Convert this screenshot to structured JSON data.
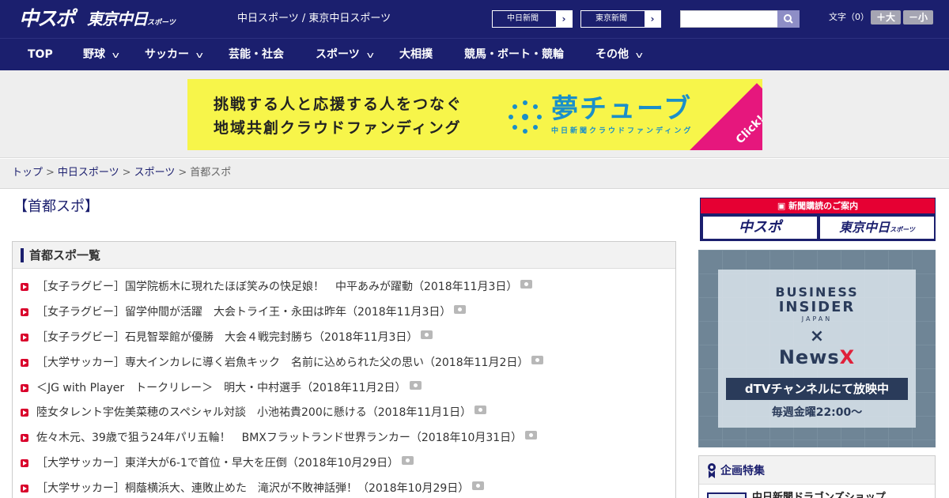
{
  "header": {
    "logo_chuspo": "中スポ",
    "logo_tokyo": "東京中日",
    "logo_tokyo_small": "スポーツ",
    "caption": "中日スポーツ / 東京中日スポーツ",
    "btn_chunichi": "中日新聞",
    "btn_tokyo": "東京新聞",
    "search_placeholder": "",
    "moji_label": "文字（0）",
    "size_up": "＋大",
    "size_down": "－小"
  },
  "nav": {
    "items": [
      {
        "label": "TOP"
      },
      {
        "label": "野球"
      },
      {
        "label": "サッカー"
      },
      {
        "label": "芸能・社会"
      },
      {
        "label": "スポーツ"
      },
      {
        "label": "大相撲"
      },
      {
        "label": "競馬・ボート・競輪"
      },
      {
        "label": "その他"
      }
    ]
  },
  "ad": {
    "line1": "挑戦する人と応援する人をつなぐ",
    "line2": "地域共創クラウドファンディング",
    "logo": "夢チューブ",
    "sub": "中日新聞クラウドファンディング",
    "click": "Click!"
  },
  "breadcrumb": {
    "top": "トップ",
    "chunichi": "中日スポーツ",
    "sports": "スポーツ",
    "current": "首都スポ",
    "sep": ">"
  },
  "main": {
    "title": "【首都スポ】",
    "list_title": "首都スポ一覧",
    "articles": [
      {
        "text": "［女子ラグビー］国学院栃木に現れたほぼ笑みの快足娘！　中平あみが躍動（2018年11月3日）"
      },
      {
        "text": "［女子ラグビー］留学仲間が活躍　大会トライ王・永田は昨年（2018年11月3日）"
      },
      {
        "text": "［女子ラグビー］石見智翠館が優勝　大会４戦完封勝ち（2018年11月3日）"
      },
      {
        "text": "［大学サッカー］専大インカレに導く岩魚キック　名前に込められた父の思い（2018年11月2日）"
      },
      {
        "text": "＜JG with Player　トークリレー＞　明大・中村選手（2018年11月2日）"
      },
      {
        "text": "陸女タレント宇佐美菜穂のスペシャル対談　小池祐貴200に懸ける（2018年11月1日）"
      },
      {
        "text": "佐々木元、39歳で狙う24年パリ五輪！　BMXフラットランド世界ランカー（2018年10月31日）"
      },
      {
        "text": "［大学サッカー］東洋大が6-1で首位・早大を圧倒（2018年10月29日）"
      },
      {
        "text": "［大学サッカー］桐蔭横浜大、連敗止めた　滝沢が不敗神話弾！（2018年10月29日）"
      }
    ]
  },
  "sidebar": {
    "subscription_head": "新聞購読のご案内",
    "sub_logo1": "中スポ",
    "sub_logo2": "東京中日",
    "sub_logo2_small": "スポーツ",
    "bi_line1": "BUSINESS",
    "bi_line2": "INSIDER",
    "bi_line3": "JAPAN",
    "bi_x": "×",
    "bi_newsx_a": "News",
    "bi_newsx_b": "X",
    "bi_strip": "dTVチャンネルにて放映中",
    "bi_time": "毎週金曜22:00〜",
    "feature_title": "企画特集",
    "feature_item": "中日新聞ドラゴンズショップ"
  },
  "colors": {
    "brand": "#1b1f6e",
    "accent_red": "#d9002b",
    "ad_yellow": "#f7f54a"
  }
}
